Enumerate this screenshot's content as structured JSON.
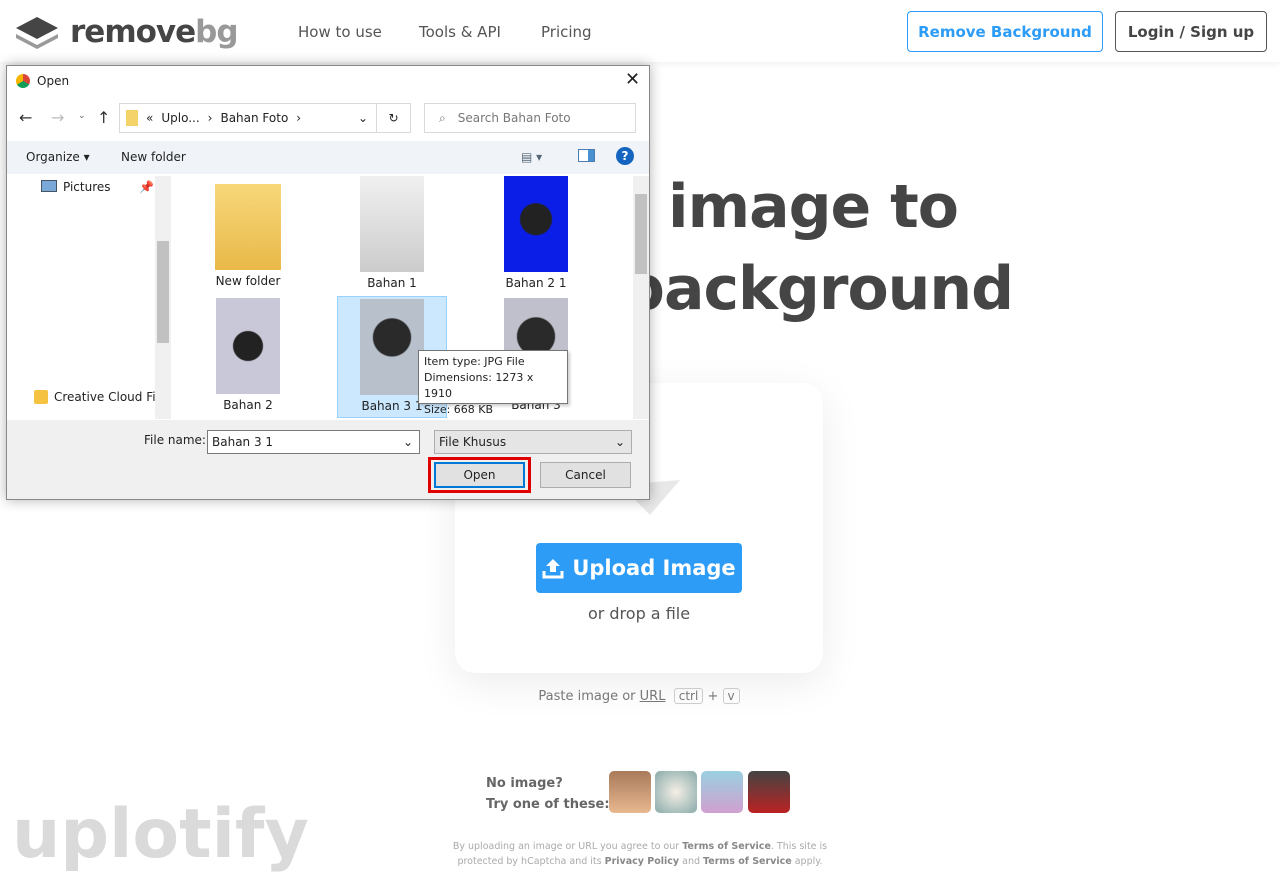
{
  "header": {
    "logo": {
      "text_main": "remove",
      "text_accent": "bg"
    },
    "nav": [
      "How to use",
      "Tools & API",
      "Pricing"
    ],
    "remove_background": "Remove Background",
    "login": "Login / Sign up",
    "accent": "#2c9cf6"
  },
  "hero": {
    "line1_visible": "image to",
    "line2_visible": "background"
  },
  "upload": {
    "button": "Upload Image",
    "drop": "or drop a file",
    "paste_prefix": "Paste image or",
    "url": "URL",
    "key1": "ctrl",
    "plus": "+",
    "key2": "v"
  },
  "samples": {
    "line1": "No image?",
    "line2": "Try one of these:"
  },
  "legal": {
    "t1": "By uploading an image or URL you agree to our",
    "tos": "Terms of Service",
    "t2": ". This site is protected by hCaptcha and its",
    "privacy": "Privacy Policy",
    "and": "and",
    "tos2": "Terms of Service",
    "t3": "apply."
  },
  "watermark": "uplotify",
  "dialog": {
    "title": "Open",
    "breadcrumb": [
      "Uplo...",
      "Bahan Foto"
    ],
    "search_placeholder": "Search Bahan Foto",
    "organize": "Organize",
    "new_folder": "New folder",
    "nav_pane": [
      "Pictures",
      "Creative Cloud Fil"
    ],
    "items": [
      {
        "label": "New folder",
        "type": "folder"
      },
      {
        "label": "Bahan 1",
        "type": "image"
      },
      {
        "label": "Bahan 2 1",
        "type": "image"
      },
      {
        "label": "Bahan 2",
        "type": "image"
      },
      {
        "label": "Bahan 3 1",
        "type": "image",
        "selected": true
      },
      {
        "label": "Bahan 3",
        "type": "image"
      }
    ],
    "tooltip": {
      "type": "Item type: JPG File",
      "dims": "Dimensions: 1273 x 1910",
      "size": "Size: 668 KB"
    },
    "filename_label": "File name:",
    "filename_value": "Bahan 3 1",
    "filter": "File Khusus",
    "open": "Open",
    "cancel": "Cancel",
    "highlight": "#e00000"
  }
}
